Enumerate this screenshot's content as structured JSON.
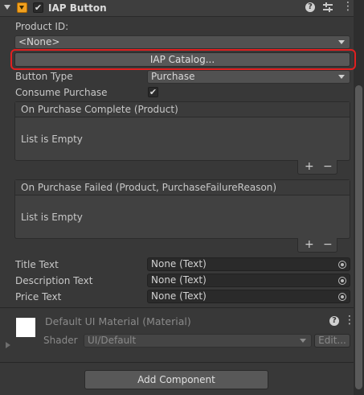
{
  "component": {
    "title": "IAP Button",
    "enabled": true
  },
  "fields": {
    "product_id_label": "Product ID:",
    "product_id_value": "<None>",
    "catalog_button": "IAP Catalog...",
    "button_type_label": "Button Type",
    "button_type_value": "Purchase",
    "consume_purchase_label": "Consume Purchase",
    "consume_purchase_checked": true
  },
  "events": [
    {
      "header": "On Purchase Complete (Product)",
      "empty_text": "List is Empty",
      "add": "+",
      "remove": "−"
    },
    {
      "header": "On Purchase Failed (Product, PurchaseFailureReason)",
      "empty_text": "List is Empty",
      "add": "+",
      "remove": "−"
    }
  ],
  "text_refs": [
    {
      "label": "Title Text",
      "value": "None (Text)"
    },
    {
      "label": "Description Text",
      "value": "None (Text)"
    },
    {
      "label": "Price Text",
      "value": "None (Text)"
    }
  ],
  "material": {
    "title": "Default UI Material (Material)",
    "shader_label": "Shader",
    "shader_value": "UI/Default",
    "edit_button": "Edit..."
  },
  "add_component": "Add Component",
  "colors": {
    "highlight": "#e02020",
    "panel": "#383838",
    "field": "#2a2a2a"
  }
}
